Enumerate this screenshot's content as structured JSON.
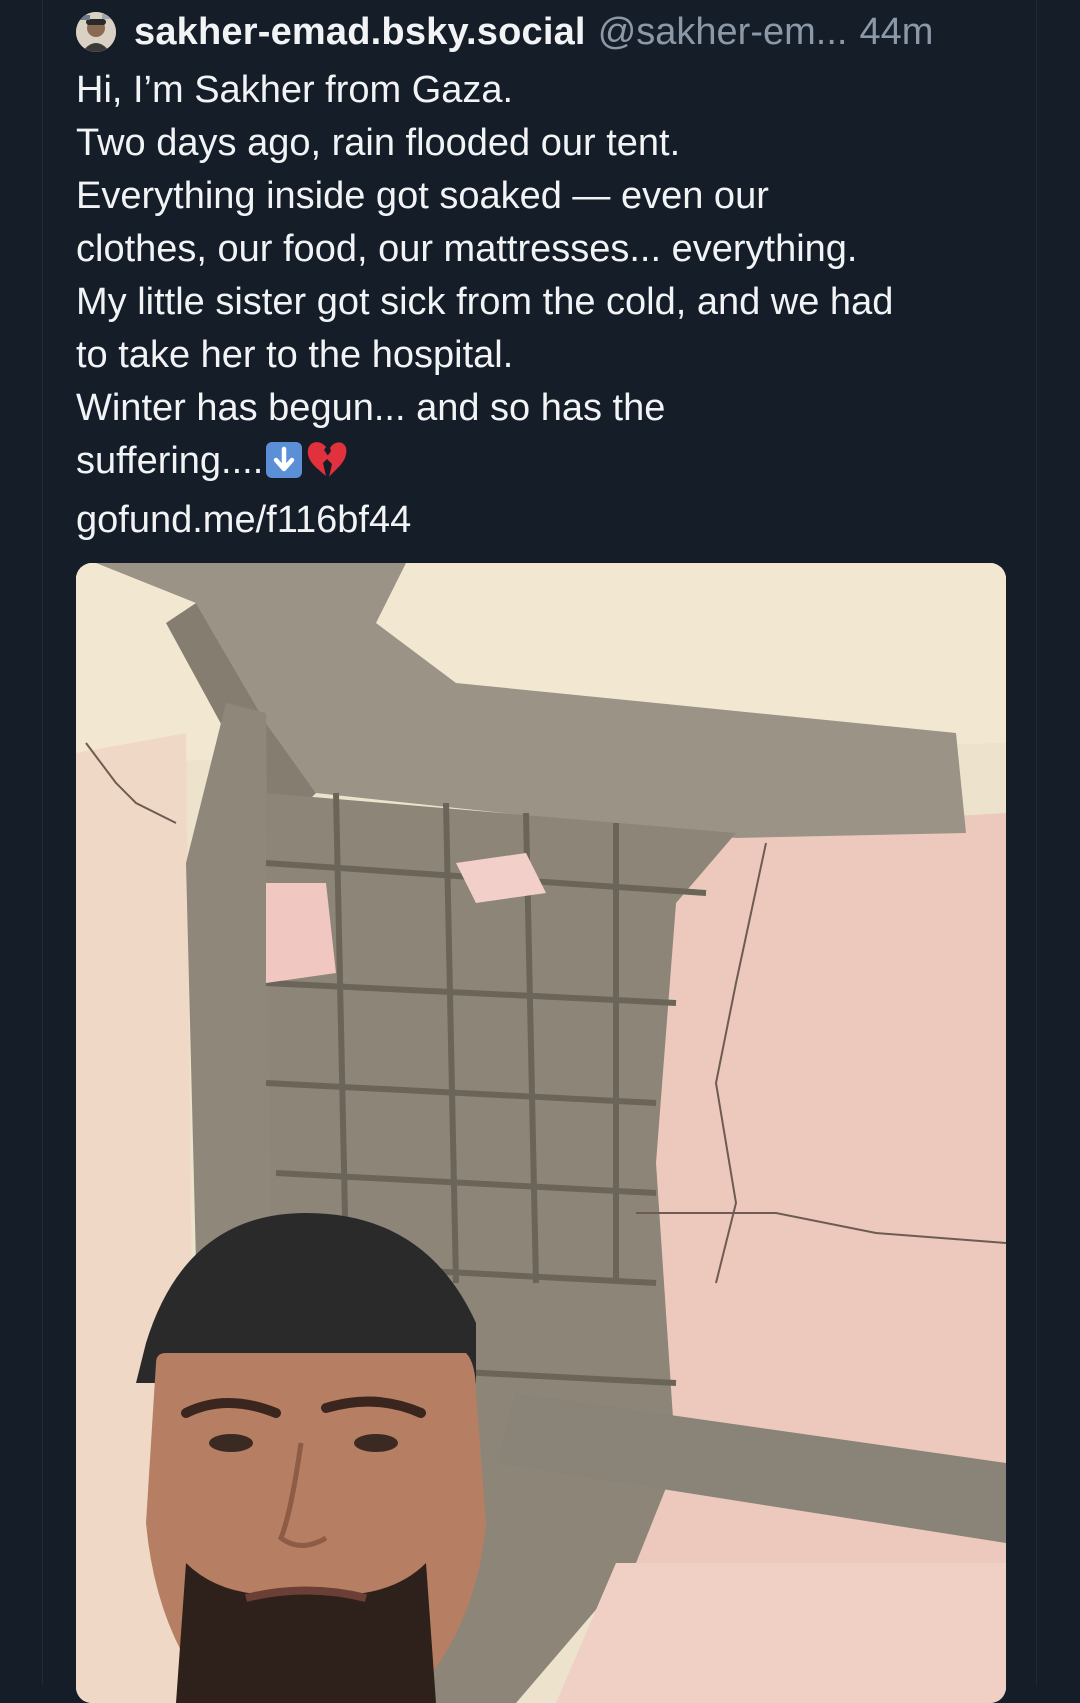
{
  "post": {
    "display_name": "sakher-emad.bsky.social",
    "handle": "@sakher-em...",
    "timestamp": "44m",
    "text_lines": [
      "Hi, I’m Sakher from Gaza.",
      "Two days ago, rain flooded our tent.",
      "Everything inside got soaked — even our",
      "clothes, our food, our mattresses... everything.",
      "My little sister got sick from the cold, and we had",
      "to take her to the hospital.",
      "Winter has begun... and so has the",
      "suffering...."
    ],
    "link": "gofund.me/f116bf44",
    "emojis": [
      "down-arrow-icon",
      "broken-heart-icon"
    ],
    "media_description_icon": "photo-damaged-wall-selfie"
  },
  "colors": {
    "background": "#151d28",
    "text": "#f1f3f5",
    "muted": "#8b98a8"
  }
}
